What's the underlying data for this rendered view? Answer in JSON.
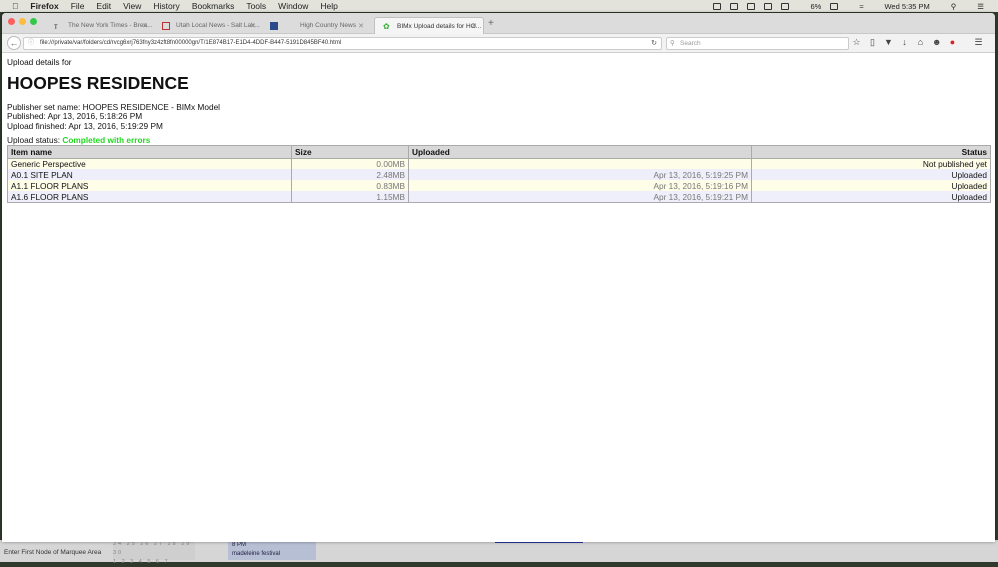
{
  "menubar": {
    "app": "Firefox",
    "items": [
      "File",
      "Edit",
      "View",
      "History",
      "Bookmarks",
      "Tools",
      "Window",
      "Help"
    ],
    "battery": "6%",
    "clock": "Wed 5:35 PM"
  },
  "tabs": [
    {
      "label": "The New York Times - Brea...",
      "active": false
    },
    {
      "label": "Utah Local News - Salt Lak...",
      "active": false
    },
    {
      "label": "High Country News",
      "active": false
    },
    {
      "label": "BIMx Upload details for HO...",
      "active": true
    }
  ],
  "toolbar": {
    "url": "file:///private/var/folders/cd/rvcg6xrj763fny3z4zft8fn00000gn/T/1E874B17-E1D4-4DDF-B447-5191D845BF40.html",
    "search_placeholder": "Search"
  },
  "page": {
    "lead": "Upload details for",
    "title": "HOOPES RESIDENCE",
    "publisher_set": "Publisher set name: HOOPES RESIDENCE - BIMx Model",
    "published": "Published: Apr 13, 2016, 5:18:26 PM",
    "finished": "Upload finished: Apr 13, 2016, 5:19:29 PM",
    "status_label": "Upload status: ",
    "status_value": "Completed with errors",
    "status_color": "#22d822",
    "columns": [
      "Item name",
      "Size",
      "Uploaded",
      "Status"
    ],
    "rows": [
      {
        "name": "Generic Perspective",
        "size": "0.00MB",
        "uploaded": "",
        "status": "Not published yet"
      },
      {
        "name": "A0.1 SITE PLAN",
        "size": "2.48MB",
        "uploaded": "Apr 13, 2016, 5:19:25 PM",
        "status": "Uploaded"
      },
      {
        "name": "A1.1 FLOOR PLANS",
        "size": "0.83MB",
        "uploaded": "Apr 13, 2016, 5:19:16 PM",
        "status": "Uploaded"
      },
      {
        "name": "A1.6 FLOOR PLANS",
        "size": "1.15MB",
        "uploaded": "Apr 13, 2016, 5:19:21 PM",
        "status": "Uploaded"
      }
    ]
  },
  "background_app": {
    "status_text": "Enter First Node of Marquee Area",
    "calendar_row1": "24 25 26 27 28 29 30",
    "calendar_row2": "1 2 3 4 5 6 7",
    "event_time": "8 PM",
    "event": "madeleine festival"
  }
}
